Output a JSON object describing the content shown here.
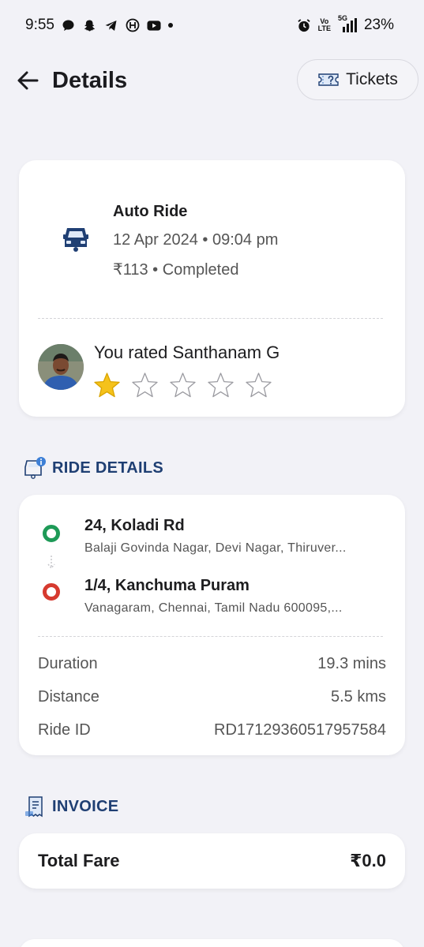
{
  "status_bar": {
    "time": "9:55",
    "net_label_top": "Vo",
    "net_label_bottom": "LTE",
    "net_5g": "5G",
    "battery": "23%"
  },
  "header": {
    "title": "Details",
    "tickets_label": "Tickets"
  },
  "ride": {
    "type": "Auto Ride",
    "datetime": "12 Apr 2024 • 09:04 pm",
    "fare_status": "₹113 • Completed",
    "rated_text": "You rated Santhanam G",
    "rating": 1,
    "rating_max": 5
  },
  "ride_details": {
    "section_title": "RIDE DETAILS",
    "pickup": {
      "title": "24, Koladi Rd",
      "address": "Balaji Govinda Nagar, Devi Nagar, Thiruver..."
    },
    "drop": {
      "title": "1/4, Kanchuma Puram",
      "address": "Vanagaram, Chennai, Tamil Nadu 600095,..."
    },
    "rows": [
      {
        "label": "Duration",
        "value": "19.3 mins"
      },
      {
        "label": "Distance",
        "value": "5.5 kms"
      },
      {
        "label": "Ride ID",
        "value": "RD17129360517957584"
      }
    ]
  },
  "invoice": {
    "section_title": "INVOICE",
    "total_label": "Total Fare",
    "total_value": "₹0.0"
  },
  "colors": {
    "accent_navy": "#1f3f73",
    "pickup_green": "#1e9a57",
    "drop_red": "#d63a2f",
    "star_gold": "#f5c21b"
  }
}
